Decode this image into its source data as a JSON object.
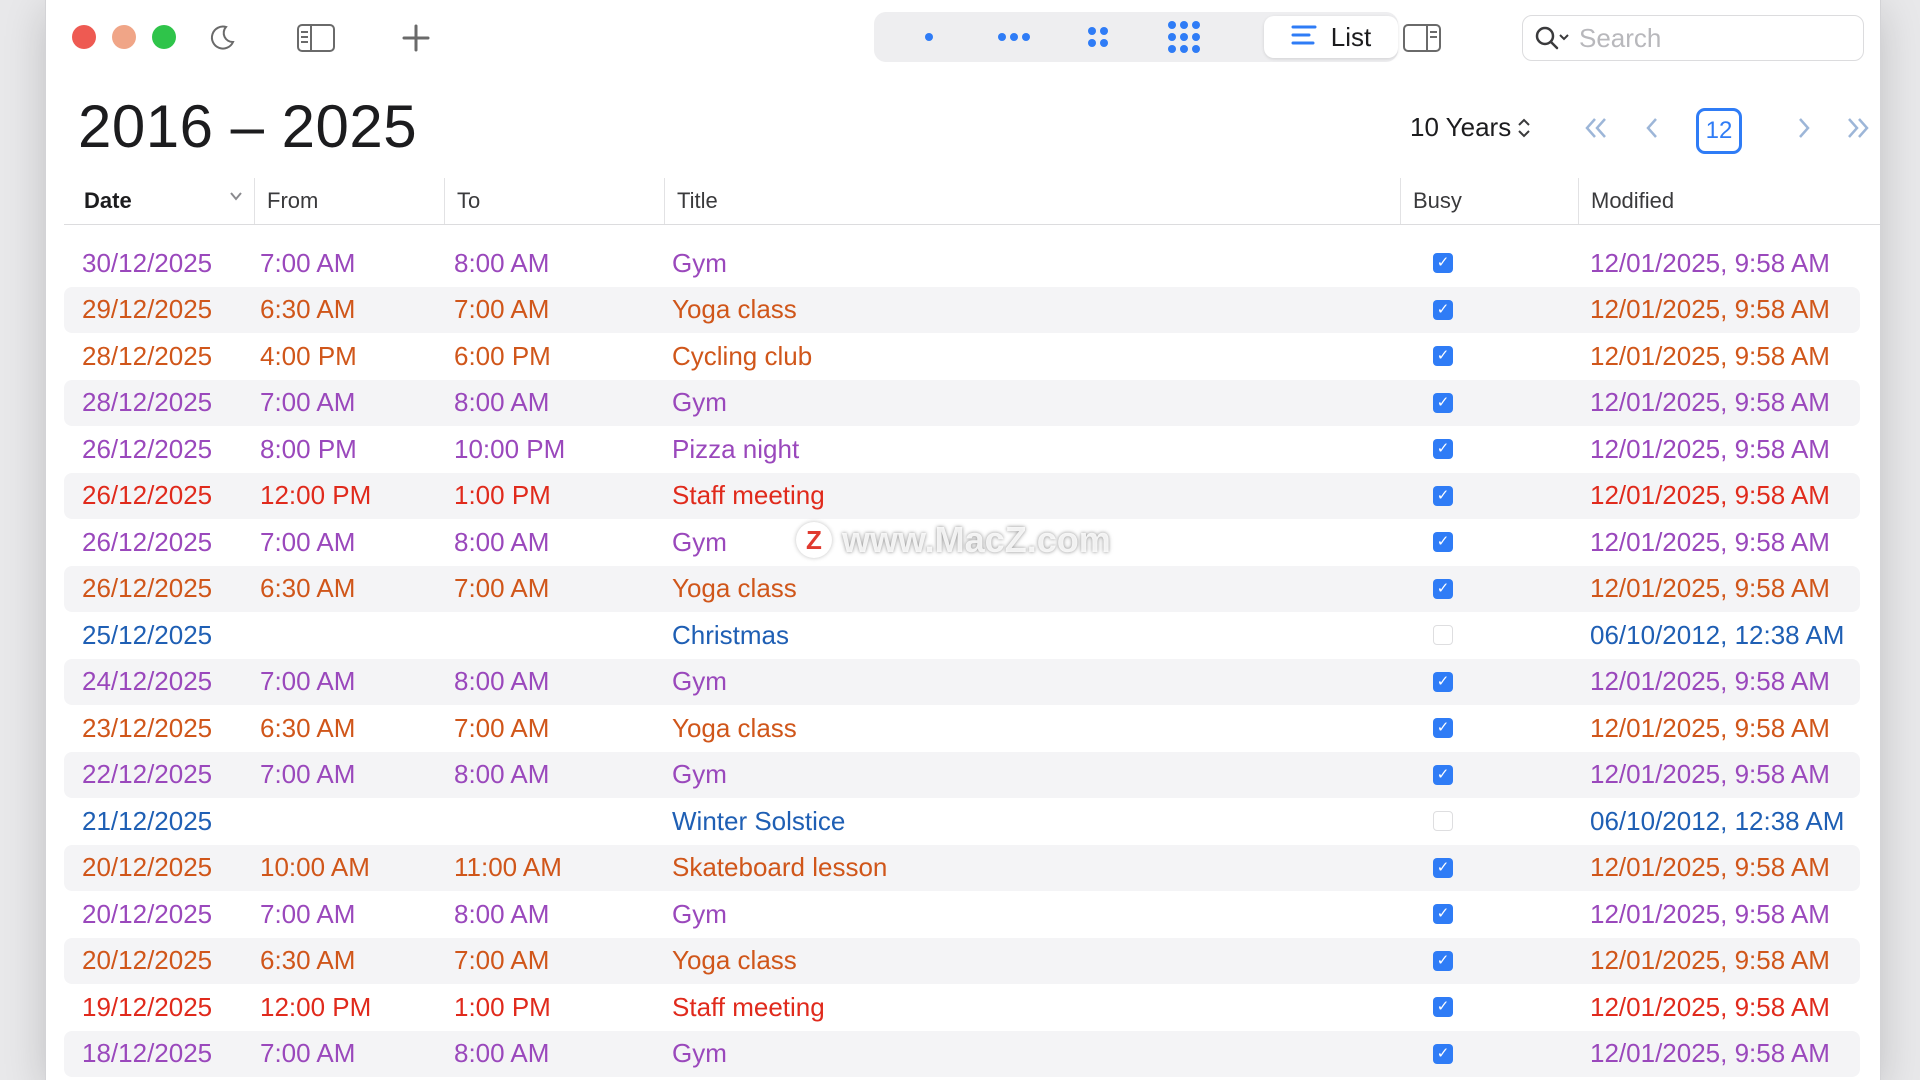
{
  "toolbar": {
    "view_list_label": "List",
    "search_placeholder": "Search"
  },
  "header": {
    "range_title": "2016 – 2025",
    "range_select": "10 Years",
    "today_day": "12"
  },
  "columns": {
    "date": "Date",
    "from": "From",
    "to": "To",
    "title": "Title",
    "busy": "Busy",
    "modified": "Modified"
  },
  "colors": {
    "purple": "#9a48bc",
    "orange": "#d0561a",
    "red": "#e02a1c",
    "blue": "#1f5fb4",
    "accent": "#2f7cf6"
  },
  "rows": [
    {
      "date": "30/12/2025",
      "from": "7:00 AM",
      "to": "8:00 AM",
      "title": "Gym",
      "busy": true,
      "modified": "12/01/2025, 9:58 AM",
      "color": "purple"
    },
    {
      "date": "29/12/2025",
      "from": "6:30 AM",
      "to": "7:00 AM",
      "title": "Yoga class",
      "busy": true,
      "modified": "12/01/2025, 9:58 AM",
      "color": "orange"
    },
    {
      "date": "28/12/2025",
      "from": "4:00 PM",
      "to": "6:00 PM",
      "title": "Cycling club",
      "busy": true,
      "modified": "12/01/2025, 9:58 AM",
      "color": "orange"
    },
    {
      "date": "28/12/2025",
      "from": "7:00 AM",
      "to": "8:00 AM",
      "title": "Gym",
      "busy": true,
      "modified": "12/01/2025, 9:58 AM",
      "color": "purple"
    },
    {
      "date": "26/12/2025",
      "from": "8:00 PM",
      "to": "10:00 PM",
      "title": "Pizza night",
      "busy": true,
      "modified": "12/01/2025, 9:58 AM",
      "color": "purple"
    },
    {
      "date": "26/12/2025",
      "from": "12:00 PM",
      "to": "1:00 PM",
      "title": "Staff meeting",
      "busy": true,
      "modified": "12/01/2025, 9:58 AM",
      "color": "red"
    },
    {
      "date": "26/12/2025",
      "from": "7:00 AM",
      "to": "8:00 AM",
      "title": "Gym",
      "busy": true,
      "modified": "12/01/2025, 9:58 AM",
      "color": "purple"
    },
    {
      "date": "26/12/2025",
      "from": "6:30 AM",
      "to": "7:00 AM",
      "title": "Yoga class",
      "busy": true,
      "modified": "12/01/2025, 9:58 AM",
      "color": "orange"
    },
    {
      "date": "25/12/2025",
      "from": "",
      "to": "",
      "title": "Christmas",
      "busy": false,
      "modified": "06/10/2012, 12:38 AM",
      "color": "blue"
    },
    {
      "date": "24/12/2025",
      "from": "7:00 AM",
      "to": "8:00 AM",
      "title": "Gym",
      "busy": true,
      "modified": "12/01/2025, 9:58 AM",
      "color": "purple"
    },
    {
      "date": "23/12/2025",
      "from": "6:30 AM",
      "to": "7:00 AM",
      "title": "Yoga class",
      "busy": true,
      "modified": "12/01/2025, 9:58 AM",
      "color": "orange"
    },
    {
      "date": "22/12/2025",
      "from": "7:00 AM",
      "to": "8:00 AM",
      "title": "Gym",
      "busy": true,
      "modified": "12/01/2025, 9:58 AM",
      "color": "purple"
    },
    {
      "date": "21/12/2025",
      "from": "",
      "to": "",
      "title": "Winter Solstice",
      "busy": false,
      "modified": "06/10/2012, 12:38 AM",
      "color": "blue"
    },
    {
      "date": "20/12/2025",
      "from": "10:00 AM",
      "to": "11:00 AM",
      "title": "Skateboard lesson",
      "busy": true,
      "modified": "12/01/2025, 9:58 AM",
      "color": "orange"
    },
    {
      "date": "20/12/2025",
      "from": "7:00 AM",
      "to": "8:00 AM",
      "title": "Gym",
      "busy": true,
      "modified": "12/01/2025, 9:58 AM",
      "color": "purple"
    },
    {
      "date": "20/12/2025",
      "from": "6:30 AM",
      "to": "7:00 AM",
      "title": "Yoga class",
      "busy": true,
      "modified": "12/01/2025, 9:58 AM",
      "color": "orange"
    },
    {
      "date": "19/12/2025",
      "from": "12:00 PM",
      "to": "1:00 PM",
      "title": "Staff meeting",
      "busy": true,
      "modified": "12/01/2025, 9:58 AM",
      "color": "red"
    },
    {
      "date": "18/12/2025",
      "from": "7:00 AM",
      "to": "8:00 AM",
      "title": "Gym",
      "busy": true,
      "modified": "12/01/2025, 9:58 AM",
      "color": "purple"
    }
  ],
  "watermark": {
    "logo_letter": "Z",
    "text": "www.MacZ.com"
  }
}
